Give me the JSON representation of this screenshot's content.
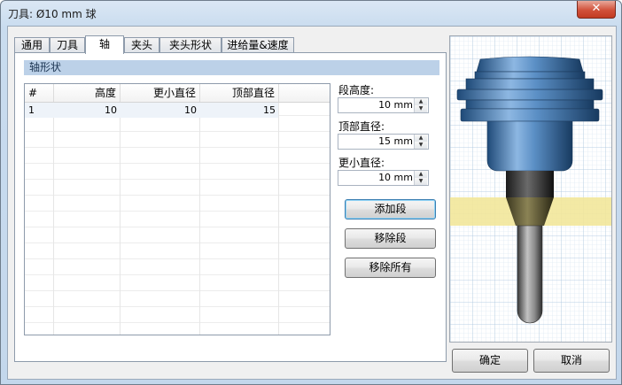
{
  "window": {
    "title": "刀具: Ø10 mm 球",
    "close_label": "✕"
  },
  "tabs": [
    {
      "label": "通用"
    },
    {
      "label": "刀具"
    },
    {
      "label": "轴"
    },
    {
      "label": "夹头"
    },
    {
      "label": "夹头形状"
    },
    {
      "label": "进给量&速度"
    }
  ],
  "active_tab": "轴",
  "section": {
    "title": "轴形状"
  },
  "table": {
    "columns": [
      "#",
      "高度",
      "更小直径",
      "顶部直径"
    ],
    "rows": [
      [
        "1",
        "10",
        "10",
        "15"
      ]
    ]
  },
  "fields": {
    "segment_height": {
      "label": "段高度:",
      "value": "10 mm"
    },
    "top_diameter": {
      "label": "顶部直径:",
      "value": "15 mm"
    },
    "smaller_diameter": {
      "label": "更小直径:",
      "value": "10 mm"
    }
  },
  "buttons": {
    "add_segment": "添加段",
    "remove_segment": "移除段",
    "remove_all": "移除所有",
    "ok": "确定",
    "cancel": "取消"
  },
  "preview": {
    "highlight_color": "#f2e79a",
    "holder_color": "#5b8fc5",
    "shank_color": "#3d3d3d",
    "segment_color": "#6b6440",
    "tool_color": "#7c7c7c"
  }
}
